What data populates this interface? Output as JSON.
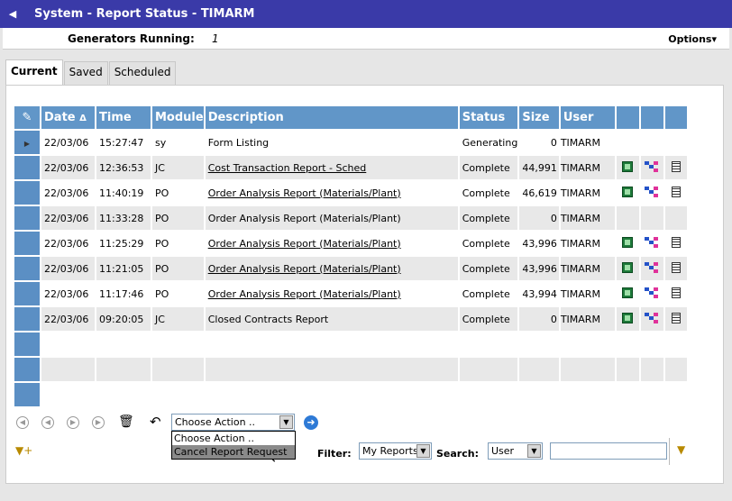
{
  "window": {
    "title": "System - Report Status - TIMARM"
  },
  "generators": {
    "label": "Generators Running:",
    "value": "1",
    "options_label": "Options"
  },
  "tabs": [
    {
      "label": "Current",
      "active": true
    },
    {
      "label": "Saved",
      "active": false
    },
    {
      "label": "Scheduled",
      "active": false
    }
  ],
  "table": {
    "columns": {
      "date": "Date",
      "time": "Time",
      "module": "Module",
      "description": "Description",
      "status": "Status",
      "size": "Size",
      "user": "User"
    },
    "sort_indicator": "Δ",
    "rows": [
      {
        "date": "22/03/06",
        "time": "15:27:47",
        "module": "sy",
        "description": "Form Listing",
        "status": "Generating",
        "size": "0",
        "user": "TIMARM",
        "link": false,
        "icons": false,
        "current": true
      },
      {
        "date": "22/03/06",
        "time": "12:36:53",
        "module": "JC",
        "description": "Cost Transaction Report - Sched",
        "status": "Complete",
        "size": "44,991",
        "user": "TIMARM",
        "link": true,
        "icons": true
      },
      {
        "date": "22/03/06",
        "time": "11:40:19",
        "module": "PO",
        "description": "Order Analysis Report (Materials/Plant)",
        "status": "Complete",
        "size": "46,619",
        "user": "TIMARM",
        "link": true,
        "icons": true
      },
      {
        "date": "22/03/06",
        "time": "11:33:28",
        "module": "PO",
        "description": "Order Analysis Report (Materials/Plant)",
        "status": "Complete",
        "size": "0",
        "user": "TIMARM",
        "link": false,
        "icons": false
      },
      {
        "date": "22/03/06",
        "time": "11:25:29",
        "module": "PO",
        "description": "Order Analysis Report (Materials/Plant)",
        "status": "Complete",
        "size": "43,996",
        "user": "TIMARM",
        "link": true,
        "icons": true
      },
      {
        "date": "22/03/06",
        "time": "11:21:05",
        "module": "PO",
        "description": "Order Analysis Report (Materials/Plant)",
        "status": "Complete",
        "size": "43,996",
        "user": "TIMARM",
        "link": true,
        "icons": true
      },
      {
        "date": "22/03/06",
        "time": "11:17:46",
        "module": "PO",
        "description": "Order Analysis Report (Materials/Plant)",
        "status": "Complete",
        "size": "43,994",
        "user": "TIMARM",
        "link": true,
        "icons": true
      },
      {
        "date": "22/03/06",
        "time": "09:20:05",
        "module": "JC",
        "description": "Closed Contracts Report",
        "status": "Complete",
        "size": "0",
        "user": "TIMARM",
        "link": false,
        "icons": true
      }
    ]
  },
  "action": {
    "selected": "Choose Action ..",
    "options": [
      "Choose Action ..",
      "Cancel Report Request"
    ],
    "highlighted": "Cancel Report Request"
  },
  "filter": {
    "label": "Filter:",
    "value": "My Reports",
    "search_label": "Search:",
    "search_field": "User",
    "search_value": ""
  },
  "colors": {
    "title_bg": "#3a3aa8",
    "header_bg": "#6196c8",
    "row_header": "#5b8fc4",
    "go": "#2e7ad6"
  }
}
